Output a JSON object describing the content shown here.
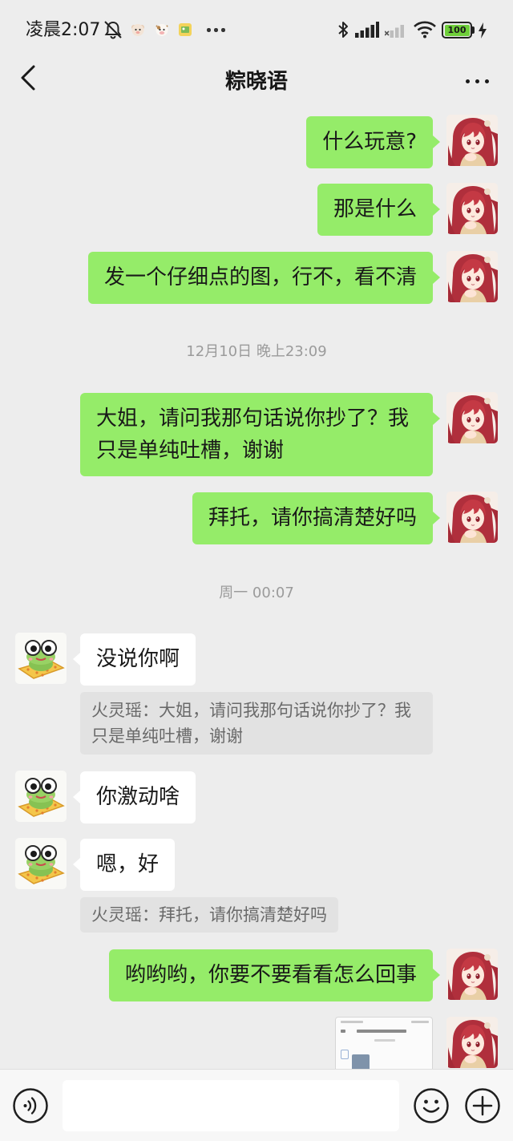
{
  "status_bar": {
    "time": "凌晨2:07",
    "battery_level": "100",
    "icons": [
      "mute-bell-icon",
      "app-notification-icon",
      "app-notification-icon",
      "app-notification-icon",
      "more-notifications-icon",
      "bluetooth-icon",
      "signal-icon",
      "signal-no-service-icon",
      "wifi-icon",
      "battery-icon",
      "charging-icon"
    ]
  },
  "header": {
    "title": "粽晓语",
    "back_icon": "chevron-left-icon",
    "menu_icon": "more-icon"
  },
  "chat": {
    "items": [
      {
        "type": "message",
        "direction": "outgoing",
        "avatar": "anime-girl-avatar",
        "text": "什么玩意?"
      },
      {
        "type": "message",
        "direction": "outgoing",
        "avatar": "anime-girl-avatar",
        "text": "那是什么"
      },
      {
        "type": "message",
        "direction": "outgoing",
        "avatar": "anime-girl-avatar",
        "text": "发一个仔细点的图，行不，看不清"
      },
      {
        "type": "timestamp",
        "text": "12月10日 晚上23:09"
      },
      {
        "type": "message",
        "direction": "outgoing",
        "avatar": "anime-girl-avatar",
        "text": "大姐，请问我那句话说你抄了？我只是单纯吐槽，谢谢"
      },
      {
        "type": "message",
        "direction": "outgoing",
        "avatar": "anime-girl-avatar",
        "text": "拜托，请你搞清楚好吗"
      },
      {
        "type": "timestamp",
        "text": "周一 00:07"
      },
      {
        "type": "message",
        "direction": "incoming",
        "avatar": "frog-avatar",
        "text": "没说你啊",
        "quote": "火灵瑶：大姐，请问我那句话说你抄了？我只是单纯吐槽，谢谢"
      },
      {
        "type": "message",
        "direction": "incoming",
        "avatar": "frog-avatar",
        "text": "你激动啥"
      },
      {
        "type": "message",
        "direction": "incoming",
        "avatar": "frog-avatar",
        "text": "嗯，好",
        "quote": "火灵瑶：拜托，请你搞清楚好吗"
      },
      {
        "type": "message",
        "direction": "outgoing",
        "avatar": "anime-girl-avatar",
        "text": "哟哟哟，你要不要看看怎么回事"
      },
      {
        "type": "image",
        "direction": "outgoing",
        "avatar": "anime-girl-avatar",
        "icon": "image-thumbnail-icon"
      }
    ]
  },
  "input_bar": {
    "value": "",
    "icons": [
      "voice-icon",
      "emoji-icon",
      "plus-icon"
    ]
  },
  "colors": {
    "background": "#ededed",
    "outgoing_bubble": "#95ec69",
    "incoming_bubble": "#ffffff",
    "quote_background": "#e2e2e2",
    "timestamp_text": "#9b9b9b",
    "battery_fill": "#6fcf3a"
  }
}
